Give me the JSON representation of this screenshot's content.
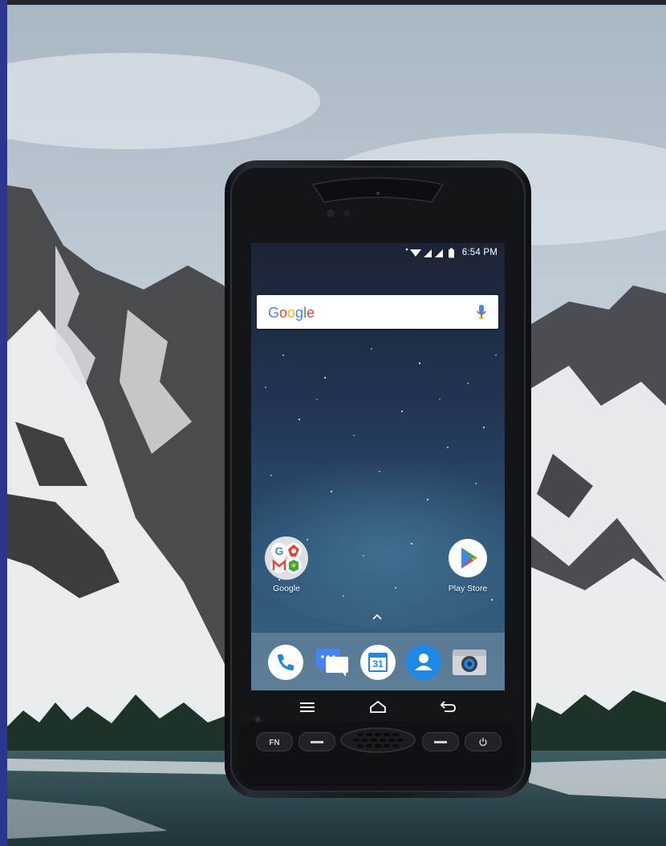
{
  "status_bar": {
    "time": "6:54 PM"
  },
  "search": {
    "logo_text": "Google",
    "logo_colors": [
      "#4285F4",
      "#EA4335",
      "#FBBC05",
      "#4285F4",
      "#34A853",
      "#EA4335"
    ]
  },
  "home": {
    "apps": [
      {
        "label": "Google",
        "icon": "google-folder-icon"
      },
      {
        "label": "Play Store",
        "icon": "play-store-icon"
      }
    ],
    "dock": [
      {
        "icon": "phone-icon"
      },
      {
        "icon": "messages-icon"
      },
      {
        "icon": "calendar-icon",
        "text": "31"
      },
      {
        "icon": "contacts-icon"
      },
      {
        "icon": "camera-icon"
      }
    ]
  },
  "hardware_keys": {
    "fn_label": "FN"
  },
  "nav": {
    "buttons": [
      "menu-icon",
      "home-icon",
      "back-icon"
    ]
  },
  "colors": {
    "accent": "#1E88E5",
    "phone_body": "#15161a",
    "sky": "#c7d3dd"
  }
}
